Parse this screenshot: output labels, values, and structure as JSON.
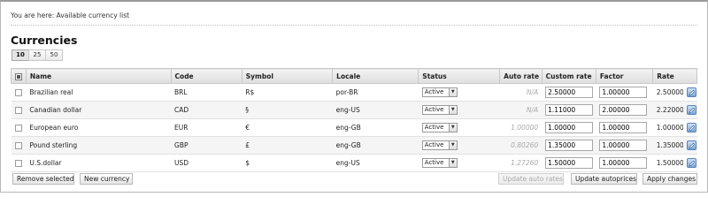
{
  "breadcrumb": "You are here: Available currency list",
  "title": "Currencies",
  "pager": [
    "10",
    "25",
    "50"
  ],
  "columns": {
    "name": "Name",
    "code": "Code",
    "symbol": "Symbol",
    "locale": "Locale",
    "status": "Status",
    "auto_rate": "Auto rate",
    "custom_rate": "Custom rate",
    "factor": "Factor",
    "rate": "Rate"
  },
  "rows": [
    {
      "name": "Brazilian real",
      "code": "BRL",
      "symbol": "R$",
      "locale": "por-BR",
      "status": "Active",
      "auto_rate": "N/A",
      "custom_rate": "2.50000",
      "factor": "1.00000",
      "rate": "2.50000"
    },
    {
      "name": "Canadian dollar",
      "code": "CAD",
      "symbol": "§",
      "locale": "eng-US",
      "status": "Active",
      "auto_rate": "N/A",
      "custom_rate": "1.11000",
      "factor": "2.00000",
      "rate": "2.22000"
    },
    {
      "name": "European euro",
      "code": "EUR",
      "symbol": "€",
      "locale": "eng-GB",
      "status": "Active",
      "auto_rate": "1.00000",
      "custom_rate": "1.00000",
      "factor": "1.00000",
      "rate": "1.00000"
    },
    {
      "name": "Pound sterling",
      "code": "GBP",
      "symbol": "£",
      "locale": "eng-GB",
      "status": "Active",
      "auto_rate": "0.80260",
      "custom_rate": "1.35000",
      "factor": "1.00000",
      "rate": "1.35000"
    },
    {
      "name": "U.S.dollar",
      "code": "USD",
      "symbol": "$",
      "locale": "eng-US",
      "status": "Active",
      "auto_rate": "1.27260",
      "custom_rate": "1.50000",
      "factor": "1.00000",
      "rate": "1.50000"
    }
  ],
  "buttons": {
    "remove_selected": "Remove selected",
    "new_currency": "New currency",
    "update_auto_rates": "Update auto rates",
    "update_autoprices": "Update autoprices",
    "apply_changes": "Apply changes"
  },
  "icons": {
    "edit": "edit-icon",
    "select_all": "select-all-checkbox-icon",
    "dropdown": "chevron-down-icon"
  },
  "colors": {
    "edit_button": "#7ea6d6",
    "header_bg": "#e4e4e4"
  }
}
